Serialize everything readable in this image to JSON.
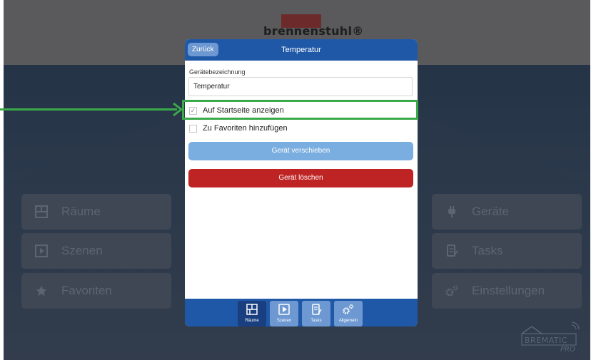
{
  "brand": {
    "name": "brennenstuhl®"
  },
  "background_menu": {
    "left": [
      {
        "label": "Räume",
        "icon": "rooms-icon"
      },
      {
        "label": "Szenen",
        "icon": "scenes-icon"
      },
      {
        "label": "Favoriten",
        "icon": "star-icon"
      }
    ],
    "right": [
      {
        "label": "Geräte",
        "icon": "plug-icon"
      },
      {
        "label": "Tasks",
        "icon": "tasks-icon"
      },
      {
        "label": "Einstellungen",
        "icon": "gears-icon"
      }
    ]
  },
  "logo": {
    "line1": "BREMATIC",
    "line2": "PRO"
  },
  "dialog": {
    "back_label": "Zurück",
    "title": "Temperatur",
    "name_label": "Gerätebezeichnung",
    "name_value": "Temperatur",
    "show_on_start": {
      "label": "Auf Startseite anzeigen",
      "checked": true
    },
    "add_favorite": {
      "label": "Zu Favoriten hinzufügen",
      "checked": false
    },
    "move_label": "Gerät verschieben",
    "delete_label": "Gerät löschen"
  },
  "tabbar": {
    "tabs": [
      {
        "label": "Räume",
        "icon": "rooms-icon",
        "active": true
      },
      {
        "label": "Szenen",
        "icon": "scenes-icon",
        "active": false
      },
      {
        "label": "Tasks",
        "icon": "tasks-icon",
        "active": false
      },
      {
        "label": "Allgemein",
        "icon": "gears-icon",
        "active": false
      }
    ]
  },
  "colors": {
    "header_blue": "#2058a8",
    "move_button": "#7aaee0",
    "delete_button": "#bf2424",
    "annotation_green": "#3aaa48"
  }
}
